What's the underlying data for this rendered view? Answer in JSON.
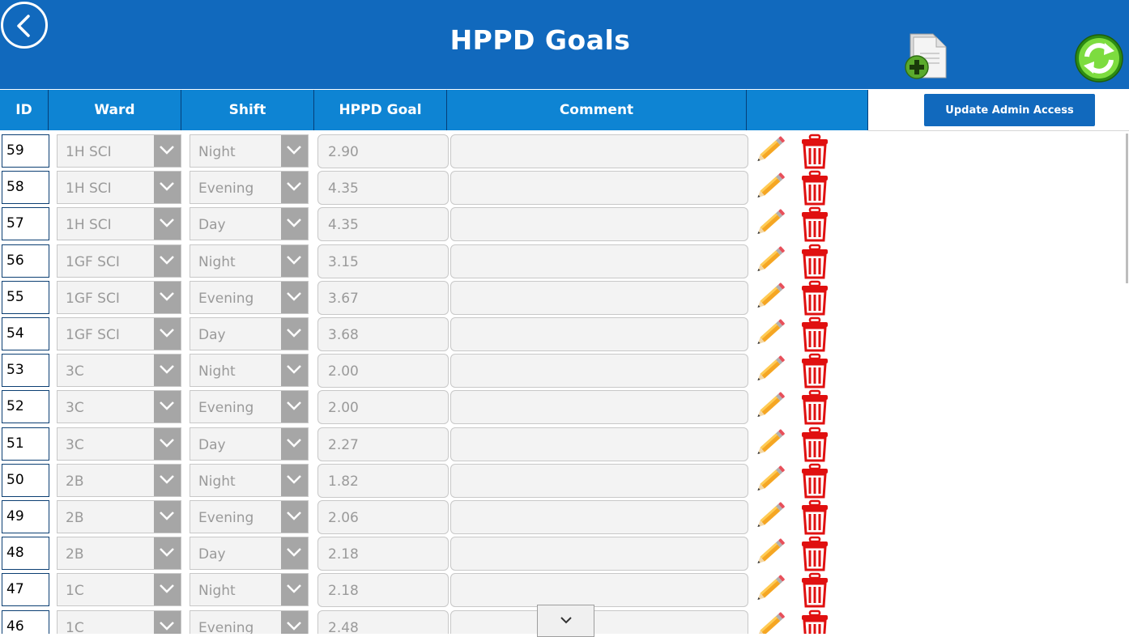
{
  "header": {
    "title": "HPPD Goals",
    "background": "#1169bd"
  },
  "toolbar": {
    "back_icon": "back-arrow-circle-icon",
    "add_icon": "add-document-icon",
    "refresh_icon": "refresh-icon",
    "admin_button_label": "Update Admin Access"
  },
  "columns": {
    "id": "ID",
    "ward": "Ward",
    "shift": "Shift",
    "hppd_goal": "HPPD Goal",
    "comment": "Comment"
  },
  "rows": [
    {
      "id": "59",
      "ward": "1H SCI",
      "shift": "Night",
      "goal": "2.90",
      "comment": ""
    },
    {
      "id": "58",
      "ward": "1H SCI",
      "shift": "Evening",
      "goal": "4.35",
      "comment": ""
    },
    {
      "id": "57",
      "ward": "1H SCI",
      "shift": "Day",
      "goal": "4.35",
      "comment": ""
    },
    {
      "id": "56",
      "ward": "1GF SCI",
      "shift": "Night",
      "goal": "3.15",
      "comment": ""
    },
    {
      "id": "55",
      "ward": "1GF SCI",
      "shift": "Evening",
      "goal": "3.67",
      "comment": ""
    },
    {
      "id": "54",
      "ward": "1GF SCI",
      "shift": "Day",
      "goal": "3.68",
      "comment": ""
    },
    {
      "id": "53",
      "ward": "3C",
      "shift": "Night",
      "goal": "2.00",
      "comment": ""
    },
    {
      "id": "52",
      "ward": "3C",
      "shift": "Evening",
      "goal": "2.00",
      "comment": ""
    },
    {
      "id": "51",
      "ward": "3C",
      "shift": "Day",
      "goal": "2.27",
      "comment": ""
    },
    {
      "id": "50",
      "ward": "2B",
      "shift": "Night",
      "goal": "1.82",
      "comment": ""
    },
    {
      "id": "49",
      "ward": "2B",
      "shift": "Evening",
      "goal": "2.06",
      "comment": ""
    },
    {
      "id": "48",
      "ward": "2B",
      "shift": "Day",
      "goal": "2.18",
      "comment": ""
    },
    {
      "id": "47",
      "ward": "1C",
      "shift": "Night",
      "goal": "2.18",
      "comment": ""
    },
    {
      "id": "46",
      "ward": "1C",
      "shift": "Evening",
      "goal": "2.48",
      "comment": ""
    }
  ]
}
